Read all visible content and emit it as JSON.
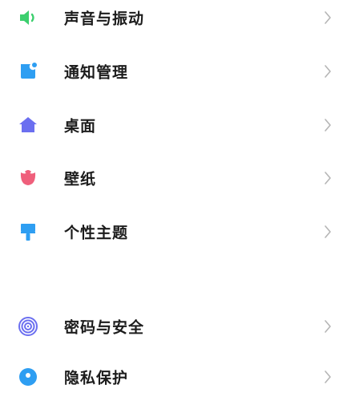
{
  "settings": {
    "group1": [
      {
        "id": "sound",
        "label": "声音与振动",
        "icon": "speaker-icon",
        "color": "#3ccf6e"
      },
      {
        "id": "notifications",
        "label": "通知管理",
        "icon": "notification-icon",
        "color": "#2e9ef2"
      },
      {
        "id": "home_screen",
        "label": "桌面",
        "icon": "home-icon",
        "color": "#6b6ff0"
      },
      {
        "id": "wallpaper",
        "label": "壁纸",
        "icon": "tulip-icon",
        "color": "#ef5f7b"
      },
      {
        "id": "themes",
        "label": "个性主题",
        "icon": "paintbrush-icon",
        "color": "#2e9ef2"
      }
    ],
    "group2": [
      {
        "id": "passwords_security",
        "label": "密码与安全",
        "icon": "fingerprint-icon",
        "color": "#6b6ff0"
      },
      {
        "id": "privacy",
        "label": "隐私保护",
        "icon": "privacy-icon",
        "color": "#2e9ef2"
      }
    ],
    "chevron_icon": "chevron-right-icon",
    "chevron_color": "#b5b5b5"
  }
}
